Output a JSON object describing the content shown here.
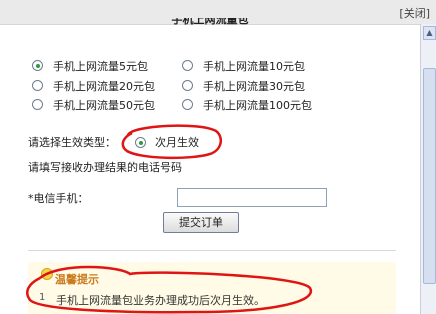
{
  "dialog": {
    "close_label": "[关闭]"
  },
  "package": {
    "title": "手机上网流量包"
  },
  "options": [
    {
      "label": "手机上网流量5元包",
      "checked": true
    },
    {
      "label": "手机上网流量10元包",
      "checked": false
    },
    {
      "label": "手机上网流量20元包",
      "checked": false
    },
    {
      "label": "手机上网流量30元包",
      "checked": false
    },
    {
      "label": "手机上网流量50元包",
      "checked": false
    },
    {
      "label": "手机上网流量100元包",
      "checked": false
    }
  ],
  "effect": {
    "label": "请选择生效类型：",
    "option_label": "次月生效",
    "checked": true
  },
  "instruction": "请填写接收办理结果的电话号码",
  "phone": {
    "label": "*电信手机：",
    "value": ""
  },
  "submit_label": "提交订单",
  "tip": {
    "title": "温馨提示",
    "number": "1",
    "text": "手机上网流量包业务办理成功后次月生效。"
  },
  "colors": {
    "annotation_red": "#e01414",
    "radio_checked": "#2f9a44"
  }
}
